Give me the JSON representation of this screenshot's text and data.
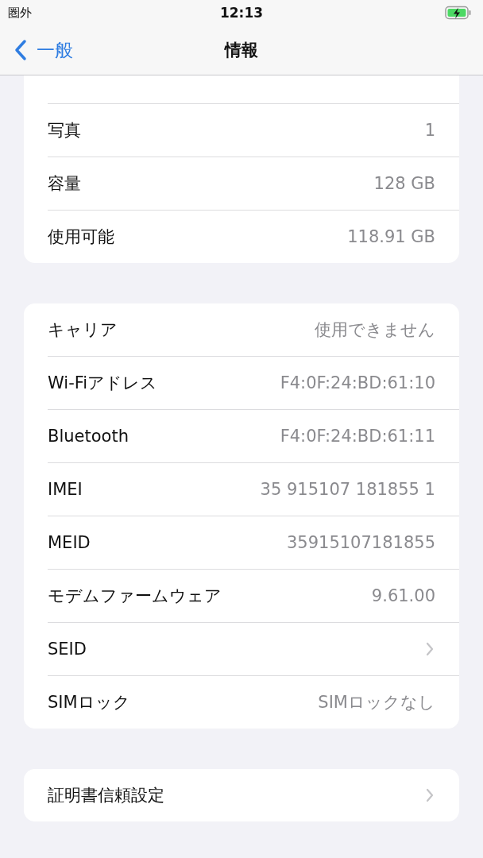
{
  "status_bar": {
    "carrier": "圏外",
    "time": "12:13",
    "charging": true
  },
  "nav": {
    "back": "一般",
    "title": "情報"
  },
  "groups": [
    {
      "rows": [
        {
          "kind": "value",
          "label": "写真",
          "value": "1"
        },
        {
          "kind": "value",
          "label": "容量",
          "value": "128 GB"
        },
        {
          "kind": "value",
          "label": "使用可能",
          "value": "118.91 GB"
        }
      ]
    },
    {
      "rows": [
        {
          "kind": "value",
          "label": "キャリア",
          "value": "使用できません"
        },
        {
          "kind": "value",
          "label": "Wi-Fiアドレス",
          "value": "F4:0F:24:BD:61:10"
        },
        {
          "kind": "value",
          "label": "Bluetooth",
          "value": "F4:0F:24:BD:61:11"
        },
        {
          "kind": "value",
          "label": "IMEI",
          "value": "35 915107 181855 1"
        },
        {
          "kind": "value",
          "label": "MEID",
          "value": "35915107181855"
        },
        {
          "kind": "value",
          "label": "モデムファームウェア",
          "value": "9.61.00"
        },
        {
          "kind": "link",
          "label": "SEID"
        },
        {
          "kind": "value",
          "label": "SIMロック",
          "value": "SIMロックなし"
        }
      ]
    },
    {
      "rows": [
        {
          "kind": "link",
          "label": "証明書信頼設定"
        }
      ]
    }
  ]
}
